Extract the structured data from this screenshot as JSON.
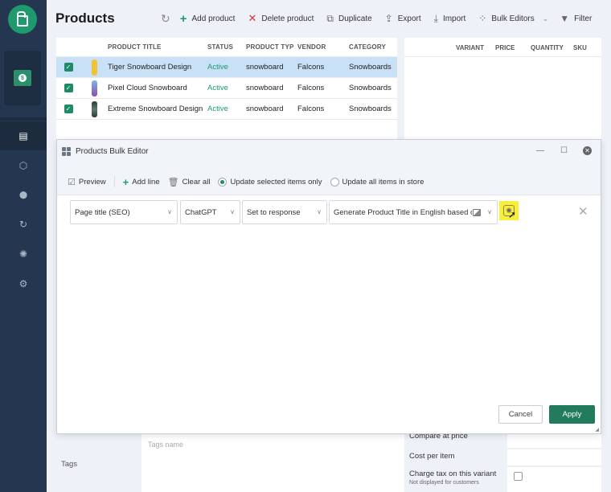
{
  "sidebar": {
    "logo_icon": "store-bag-icon",
    "store_icon": "dollar-store-icon",
    "items": [
      {
        "name": "products",
        "icon": "document-list-icon",
        "glyph": "▤",
        "active": true
      },
      {
        "name": "inventory",
        "icon": "cube-icon",
        "glyph": "⬡",
        "active": false
      },
      {
        "name": "locations",
        "icon": "map-pin-icon",
        "glyph": "⬤",
        "active": false
      },
      {
        "name": "sync",
        "icon": "refresh-c-icon",
        "glyph": "↻",
        "active": false
      },
      {
        "name": "ai",
        "icon": "openai-icon",
        "glyph": "✺",
        "active": false
      },
      {
        "name": "settings",
        "icon": "gear-icon",
        "glyph": "⚙",
        "active": false
      }
    ]
  },
  "header": {
    "title": "Products",
    "toolbar": {
      "refresh_icon": "↻",
      "add_product": "Add product",
      "delete_product": "Delete product",
      "duplicate": "Duplicate",
      "export": "Export",
      "import": "Import",
      "bulk_editors": "Bulk Editors",
      "filter": "Filter"
    }
  },
  "products_table": {
    "columns": [
      "PRODUCT TITLE",
      "STATUS",
      "PRODUCT TYP",
      "VENDOR",
      "CATEGORY"
    ],
    "rows": [
      {
        "title": "Tiger Snowboard Design",
        "status": "Active",
        "type": "snowboard",
        "vendor": "Falcons",
        "category": "Snowboards",
        "checked": true,
        "selected": true,
        "thumb_color": "#f0c23a"
      },
      {
        "title": "Pixel Cloud Snowboard",
        "status": "Active",
        "type": "snowboard",
        "vendor": "Falcons",
        "category": "Snowboards",
        "checked": true,
        "selected": false,
        "thumb_color": "#8a4fa8"
      },
      {
        "title": "Extreme Snowboard Design",
        "status": "Active",
        "type": "snowboard",
        "vendor": "Falcons",
        "category": "Snowboards",
        "checked": true,
        "selected": false,
        "thumb_color": "#2f3a3a"
      }
    ]
  },
  "variants_table": {
    "columns": [
      "VARIANT",
      "PRICE",
      "QUANTITY",
      "SKU"
    ]
  },
  "form": {
    "tags_label": "Tags",
    "tags_placeholder": "Tags name",
    "compare_at_price": "Compare at price",
    "cost_per_item": "Cost per item",
    "charge_tax": "Charge tax on this variant",
    "charge_tax_sub": "Not displayed for customers"
  },
  "dialog": {
    "title": "Products Bulk Editor",
    "minimize": "—",
    "maximize": "☐",
    "close": "✕",
    "toolbar": {
      "preview": "Preview",
      "add_line": "Add line",
      "clear_all": "Clear all",
      "update_selected": "Update selected items only",
      "update_all": "Update all items in store",
      "selected_scope": "selected"
    },
    "line": {
      "field": "Page title (SEO)",
      "source": "ChatGPT",
      "action": "Set to response",
      "prompt": "Generate Product Title in English based or"
    },
    "cancel": "Cancel",
    "apply": "Apply"
  },
  "colors": {
    "brand_green": "#1e9a6e",
    "apply_green": "#237b5d",
    "sidebar_bg": "#243650",
    "selected_row": "#c8e1f7",
    "highlight_yellow": "#f7ef3c"
  }
}
